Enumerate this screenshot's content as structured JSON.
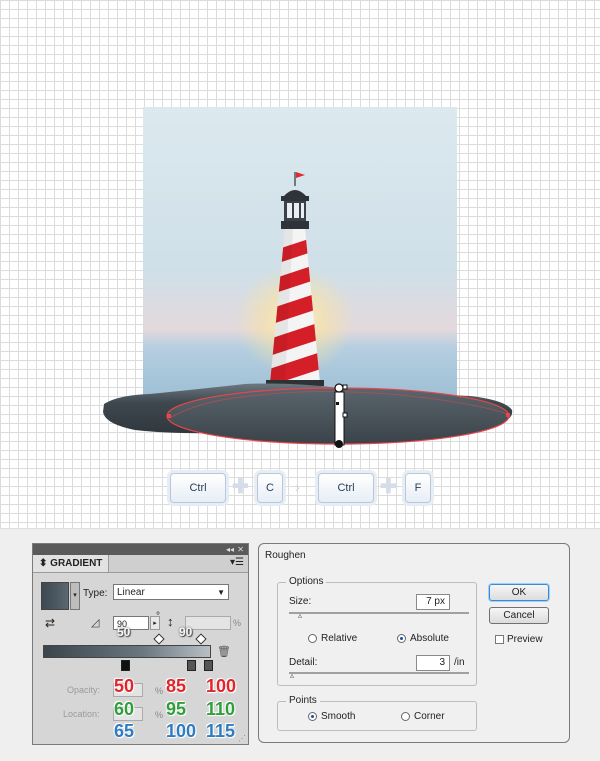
{
  "shortcut": {
    "key1": "Ctrl",
    "key2": "C",
    "key3": "Ctrl",
    "key4": "F"
  },
  "gradient_panel": {
    "tab_label": "GRADIENT",
    "type_label": "Type:",
    "type_value": "Linear",
    "angle_value": "90",
    "angle_overlay": "50",
    "aspect_overlay": "90",
    "percent": "%",
    "degree": "°",
    "opacity_label": "Opacity:",
    "location_label": "Location:",
    "opacity_numbers": [
      "50",
      "85",
      "100"
    ],
    "green_numbers": [
      "60",
      "95",
      "110"
    ],
    "location_numbers": [
      "65",
      "100",
      "115"
    ]
  },
  "roughen_dialog": {
    "title": "Roughen",
    "options_legend": "Options",
    "size_label": "Size:",
    "size_value": "7 px",
    "relative_label": "Relative",
    "absolute_label": "Absolute",
    "detail_label": "Detail:",
    "detail_value": "3",
    "detail_unit": "/in",
    "points_legend": "Points",
    "smooth_label": "Smooth",
    "corner_label": "Corner",
    "ok_label": "OK",
    "cancel_label": "Cancel",
    "preview_label": "Preview",
    "selected_mode": "Absolute",
    "selected_points": "Smooth"
  },
  "colors": {
    "accent_red": "#e2242b",
    "accent_green": "#2f9e3b",
    "accent_blue": "#2f7cc2",
    "selection_red": "#e8474a"
  }
}
